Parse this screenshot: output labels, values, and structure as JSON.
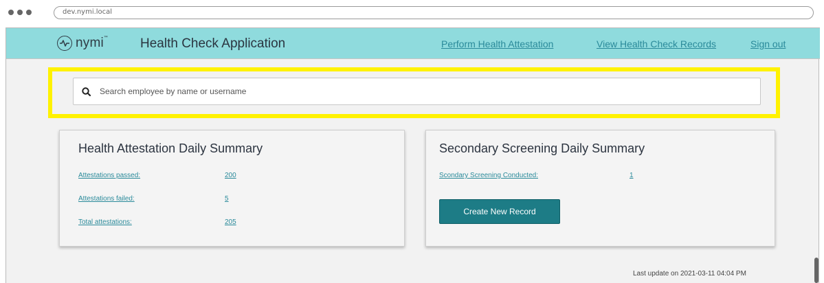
{
  "browser": {
    "url": "dev.nymi.local"
  },
  "header": {
    "logo_text": "nymi",
    "logo_tm": "™",
    "app_title": "Health Check Application",
    "nav": [
      {
        "label": "Perform Health Attestation"
      },
      {
        "label": "View Health Check Records"
      },
      {
        "label": "Sign out"
      }
    ]
  },
  "search": {
    "placeholder": "Search employee by name or username",
    "value": "",
    "icon": "search-icon"
  },
  "health_summary": {
    "title": "Health Attestation Daily Summary",
    "rows": [
      {
        "label": "Attestations passed:",
        "value": "200"
      },
      {
        "label": "Attestations failed:",
        "value": "5"
      },
      {
        "label": "Total attestations:",
        "value": "205"
      }
    ]
  },
  "secondary_summary": {
    "title": "Secondary Screening Daily Summary",
    "rows": [
      {
        "label": "Scondary Screening Conducted:",
        "value": "1"
      }
    ],
    "create_button": "Create  New Record"
  },
  "footer": {
    "last_update": "Last update on 2021-03-11 04:04 PM"
  },
  "colors": {
    "header_bg": "#8fdbdd",
    "link": "#2a8a9a",
    "button": "#1d7c86",
    "highlight": "#fff200"
  }
}
